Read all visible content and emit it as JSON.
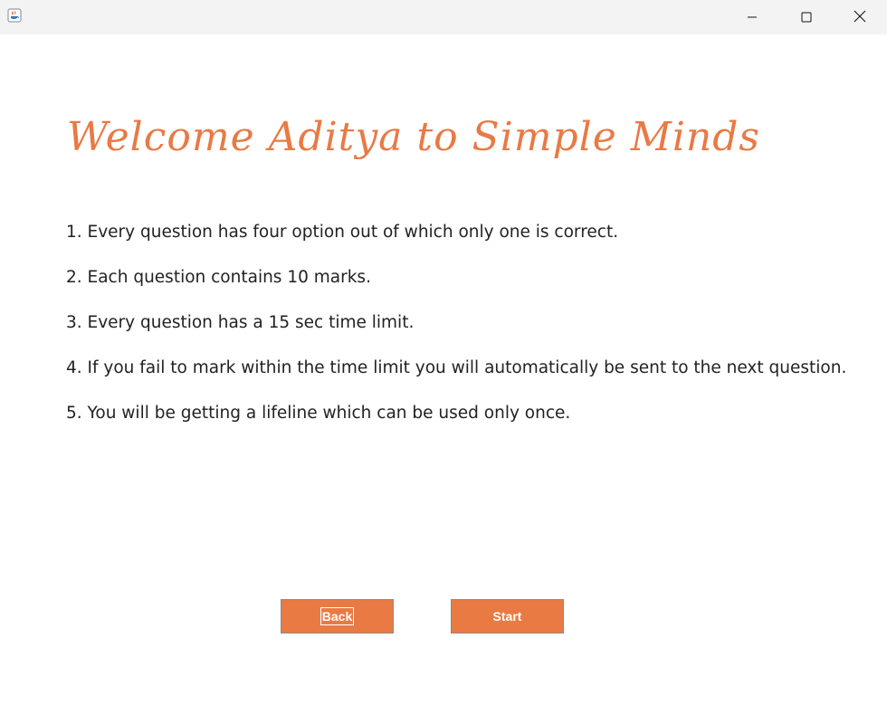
{
  "window": {
    "icon": "java-app-icon",
    "controls": {
      "minimize": "minimize-icon",
      "maximize": "maximize-icon",
      "close": "close-icon"
    }
  },
  "heading": "Welcome Aditya to Simple Minds",
  "rules": [
    "1. Every question has four option out of which only one is correct.",
    "2. Each question contains 10 marks.",
    "3. Every question has a 15 sec time limit.",
    "4. If you fail to mark within the time limit you will automatically be sent to the next question.",
    "5. You will be getting a lifeline which can be used only once."
  ],
  "buttons": {
    "back": "Back",
    "start": "Start"
  },
  "colors": {
    "accent": "#e87a45",
    "text": "#222222",
    "titlebar": "#f3f3f3"
  }
}
